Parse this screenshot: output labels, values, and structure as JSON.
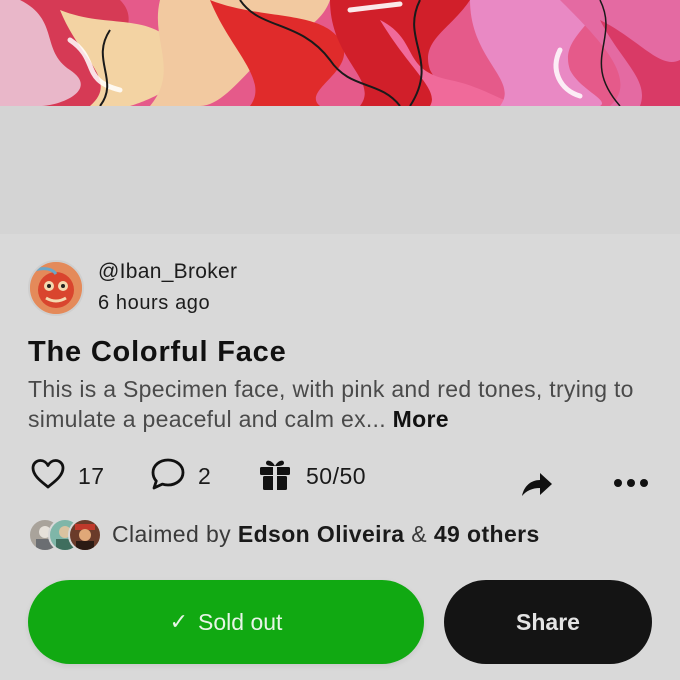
{
  "post": {
    "author_handle": "@Iban_Broker",
    "timestamp": "6 hours ago",
    "title": "The Colorful Face",
    "description": "This is a Specimen face, with pink and red tones, trying to simulate a peaceful and calm ex...",
    "more_label": "More"
  },
  "actions": {
    "likes": "17",
    "comments": "2",
    "gifts": "50/50",
    "like_icon": "heart-icon",
    "comment_icon": "speech-bubble-icon",
    "gift_icon": "gift-icon",
    "share_icon": "share-arrow-icon",
    "more_icon": "ellipsis-icon"
  },
  "claimed": {
    "prefix": "Claimed by",
    "name": "Edson Oliveira",
    "joiner": "&",
    "others": "49 others"
  },
  "buttons": {
    "sold_out_check": "✓",
    "sold_out_label": "Sold out",
    "share_label": "Share"
  },
  "colors": {
    "sold_out_bg": "#11a912",
    "share_bg": "#141414",
    "background": "#d9d9d9"
  }
}
